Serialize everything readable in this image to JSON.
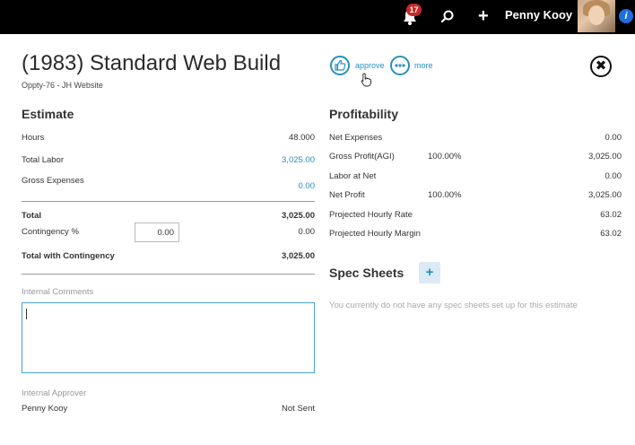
{
  "topbar": {
    "notification_count": "17",
    "user_name": "Penny Kooy",
    "info_glyph": "i"
  },
  "header": {
    "title": "(1983) Standard Web Build",
    "subtitle": "Oppty-76 - JH Website",
    "approve_label": "approve",
    "more_label": "more",
    "close_glyph": "✖"
  },
  "estimate": {
    "heading": "Estimate",
    "hours_label": "Hours",
    "hours_value": "48.000",
    "total_labor_label": "Total Labor",
    "total_labor_value": "3,025.00",
    "gross_expenses_label": "Gross Expenses",
    "gross_expenses_value": "0.00",
    "total_label": "Total",
    "total_value": "3,025.00",
    "contingency_label": "Contingency %",
    "contingency_input": "0.00",
    "contingency_value": "0.00",
    "total_with_contingency_label": "Total with Contingency",
    "total_with_contingency_value": "3,025.00",
    "internal_comments_label": "Internal Comments",
    "internal_approver_label": "Internal Approver",
    "approver_name": "Penny Kooy",
    "approver_status": "Not Sent"
  },
  "profitability": {
    "heading": "Profitability",
    "net_expenses_label": "Net Expenses",
    "net_expenses_value": "0.00",
    "gross_profit_label": "Gross Profit(AGI)",
    "gross_profit_pct": "100.00%",
    "gross_profit_value": "3,025.00",
    "labor_at_net_label": "Labor at Net",
    "labor_at_net_value": "0.00",
    "net_profit_label": "Net Profit",
    "net_profit_pct": "100.00%",
    "net_profit_value": "3,025.00",
    "projected_hourly_rate_label": "Projected Hourly Rate",
    "projected_hourly_rate_value": "63.02",
    "projected_hourly_margin_label": "Projected Hourly Margin",
    "projected_hourly_margin_value": "63.02"
  },
  "spec_sheets": {
    "heading": "Spec Sheets",
    "add_glyph": "+",
    "empty_message": "You currently do not have any spec sheets set up for this estimate"
  },
  "icons": {
    "bell": "bell-icon",
    "search": "search-icon",
    "add": "plus-icon",
    "approve": "thumbs-up-icon",
    "more": "ellipsis-icon",
    "close": "close-icon",
    "cursor": "hand-pointer-icon"
  },
  "colors": {
    "accent": "#2a8fc0",
    "badge": "#c62828",
    "info": "#1e6fd9"
  }
}
